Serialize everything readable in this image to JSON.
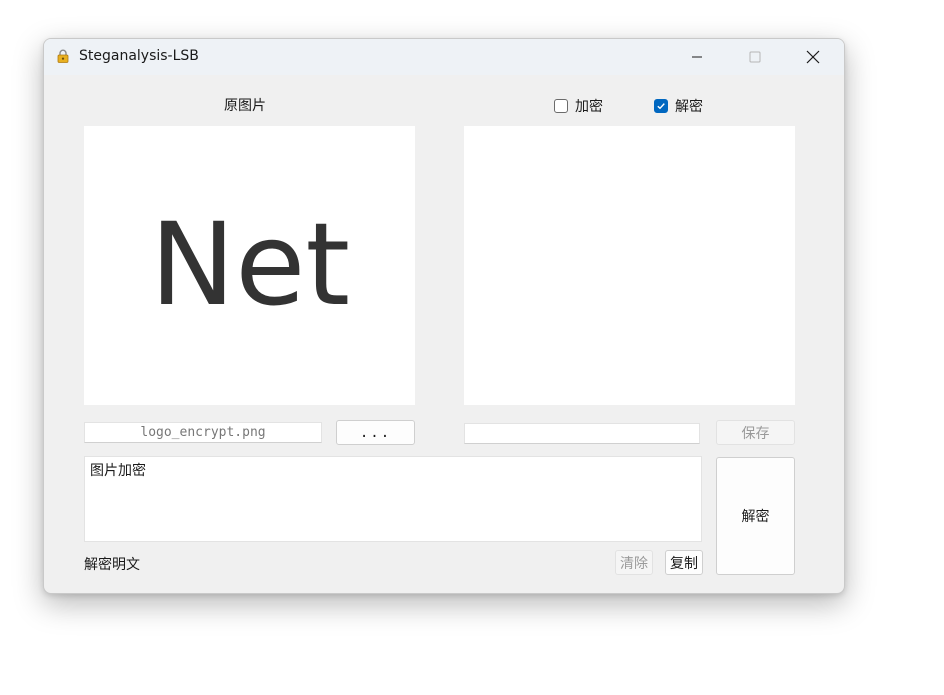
{
  "window": {
    "title": "Steganalysis-LSB",
    "app_icon": "lock-icon",
    "controls": [
      "minimize-icon",
      "maximize-icon",
      "close-icon"
    ]
  },
  "left": {
    "heading": "原图片",
    "image_text": "Net",
    "filename_value": "logo_encrypt.png",
    "browse_label": "..."
  },
  "right": {
    "mode_encrypt": {
      "label": "加密",
      "checked": false
    },
    "mode_decrypt": {
      "label": "解密",
      "checked": true
    },
    "output_path_value": "",
    "save_label": "保存"
  },
  "text": {
    "content": "图片加密",
    "caption": "解密明文",
    "clear_label": "清除",
    "copy_label": "复制"
  },
  "action": {
    "label": "解密"
  },
  "colors": {
    "accent": "#0067c0",
    "window_bg": "#f0f0f0",
    "titlebar_bg": "#eef2f6"
  }
}
